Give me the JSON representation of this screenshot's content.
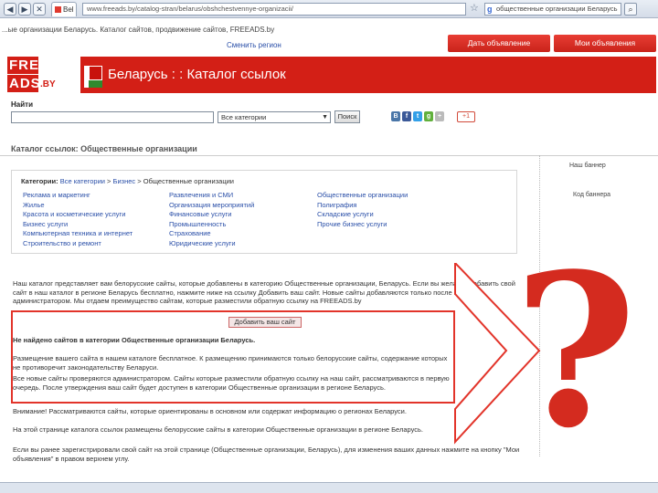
{
  "browser": {
    "tab_label": "Bel",
    "url": "www.freeads.by/catalog-stran/belarus/obshchestvennye-organizacii/",
    "search_value": "общественные организации Беларусь"
  },
  "site": {
    "tagline": "...ые организации Беларусь. Каталог сайтов, продвижение сайтов, FREEADS.by",
    "change_region": "Сменить регион",
    "btn_post_ad": "Дать объявление",
    "btn_my_ads": "Мои объявления",
    "logo_line1": "FREE",
    "logo_line2": "ADS",
    "logo_suffix": ".BY",
    "header_title": "Беларусь : : Каталог ссылок"
  },
  "search": {
    "label": "Найти",
    "category_value": "Все категории",
    "button": "Поиск",
    "socials": [
      "В",
      "f",
      "t",
      "g",
      "+"
    ],
    "gplus": "+1"
  },
  "catalog": {
    "heading": "Каталог ссылок: Общественные организации",
    "crumbs_label": "Категории:",
    "crumbs_all": "Все категории",
    "crumbs_mid": "Бизнес",
    "crumbs_current": "Общественные организации",
    "col1": [
      "Реклама и маркетинг",
      "Жилье",
      "Красота и косметические услуги",
      "Бизнес услуги",
      "Компьютерная техника и интернет",
      "Строительство и ремонт"
    ],
    "col2": [
      "Развлечения и СМИ",
      "Организация мероприятий",
      "Финансовые услуги",
      "Промышленность",
      "Страхование",
      "Юридические услуги"
    ],
    "col3": [
      "Общественные организации",
      "Полиграфия",
      "Складские услуги",
      "Прочие бизнес услуги"
    ]
  },
  "sidebar": {
    "line1": "Наш баннер",
    "line2": "Код баннера"
  },
  "content": {
    "intro": "Наш каталог представляет вам белорусские сайты, которые добавлены в категорию Общественные организации, Беларусь. Если вы желаете добавить свой сайт в наш каталог в регионе Беларусь бесплатно, нажмите ниже на ссылку Добавить ваш сайт. Новые сайты добавляются только после проверки администратором. Мы отдаем преимущество сайтам, которые разместили обратную ссылку на FREEADS.by",
    "add_button": "Добавить ваш сайт",
    "not_found": "Не найдено сайтов в категории Общественные организации Беларусь.",
    "rules": "Размещение вашего сайта в нашем каталоге бесплатное. К размещению принимаются только белорусские сайты, содержание которых не противоречит законодательству Беларуси.",
    "moderation": "Все новые сайты проверяются администратором. Сайты которые разместили обратную ссылку на наш сайт, рассматриваются в первую очередь. После утверждения ваш сайт будет доступен в категории Общественные организации в регионе Беларусь.",
    "attention": "Внимание! Рассматриваются сайты, которые ориентированы в основном или содержат информацию о регионах Беларуси.",
    "page_info": "На этой странице каталога ссылок размещены белорусские сайты в категории Общественные организации в регионе Беларусь.",
    "registered": "Если вы ранее зарегистрировали свой сайт на этой странице (Общественные организации, Беларусь), для изменения ваших данных нажмите на кнопку \"Мои объявления\" в правом верхнем углу."
  },
  "overlay": {
    "question_mark": "?"
  },
  "colors": {
    "accent": "#d31f16",
    "link": "#2a4fa8"
  }
}
